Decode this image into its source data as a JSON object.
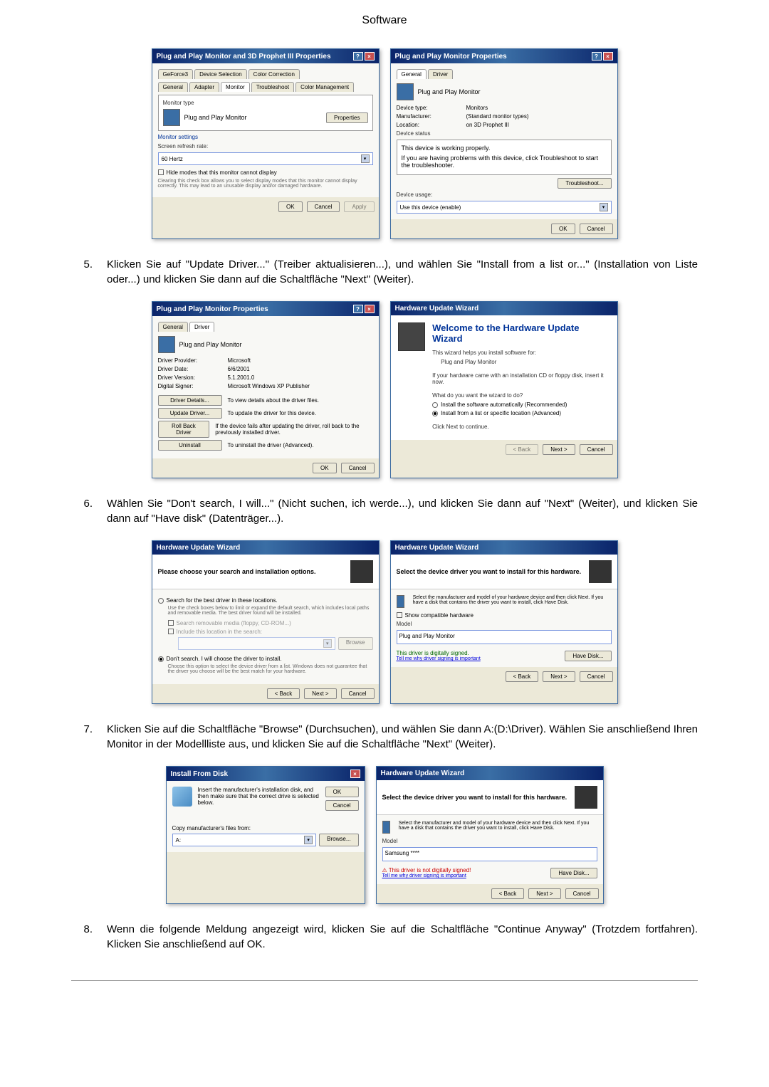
{
  "header": "Software",
  "step5": {
    "num": "5.",
    "text": "Klicken Sie auf \"Update Driver...\" (Treiber aktualisieren...), und wählen Sie \"Install from a list or...\" (Installation von Liste oder...) und klicken Sie dann auf die Schaltfläche \"Next\" (Weiter)."
  },
  "step6": {
    "num": "6.",
    "text": "Wählen Sie \"Don't search, I will...\" (Nicht suchen, ich werde...), und klicken Sie dann auf \"Next\" (Weiter), und klicken Sie dann auf \"Have disk\" (Datenträger...)."
  },
  "step7": {
    "num": "7.",
    "text": "Klicken Sie auf die Schaltfläche \"Browse\" (Durchsuchen), und wählen Sie dann A:(D:\\Driver). Wählen Sie anschließend Ihren Monitor in der Modellliste aus, und klicken Sie auf die Schaltfläche \"Next\" (Weiter)."
  },
  "step8": {
    "num": "8.",
    "text": "Wenn die folgende Meldung angezeigt wird, klicken Sie auf die Schaltfläche \"Continue Anyway\" (Trotzdem fortfahren). Klicken Sie anschließend auf OK."
  },
  "dialog1": {
    "title": "Plug and Play Monitor and 3D Prophet III Properties",
    "tabs": [
      "GeForce3",
      "Device Selection",
      "Color Correction"
    ],
    "tabs2": [
      "General",
      "Adapter",
      "Monitor",
      "Troubleshoot",
      "Color Management"
    ],
    "monitor_type_label": "Monitor type",
    "monitor_type": "Plug and Play Monitor",
    "properties_btn": "Properties",
    "monitor_settings": "Monitor settings",
    "refresh_label": "Screen refresh rate:",
    "refresh_value": "60 Hertz",
    "hide_modes": "Hide modes that this monitor cannot display",
    "hide_desc": "Clearing this check box allows you to select display modes that this monitor cannot display correctly. This may lead to an unusable display and/or damaged hardware.",
    "ok": "OK",
    "cancel": "Cancel",
    "apply": "Apply"
  },
  "dialog2": {
    "title": "Plug and Play Monitor Properties",
    "tabs": [
      "General",
      "Driver"
    ],
    "name": "Plug and Play Monitor",
    "device_type_label": "Device type:",
    "device_type": "Monitors",
    "manufacturer_label": "Manufacturer:",
    "manufacturer": "(Standard monitor types)",
    "location_label": "Location:",
    "location": "on 3D Prophet III",
    "status_label": "Device status",
    "status_text": "This device is working properly.",
    "status_desc": "If you are having problems with this device, click Troubleshoot to start the troubleshooter.",
    "troubleshoot": "Troubleshoot...",
    "usage_label": "Device usage:",
    "usage_value": "Use this device (enable)",
    "ok": "OK",
    "cancel": "Cancel"
  },
  "dialog3": {
    "title": "Plug and Play Monitor Properties",
    "tabs": [
      "General",
      "Driver"
    ],
    "name": "Plug and Play Monitor",
    "provider_label": "Driver Provider:",
    "provider": "Microsoft",
    "date_label": "Driver Date:",
    "date": "6/6/2001",
    "version_label": "Driver Version:",
    "version": "5.1.2001.0",
    "signer_label": "Digital Signer:",
    "signer": "Microsoft Windows XP Publisher",
    "details_btn": "Driver Details...",
    "details_desc": "To view details about the driver files.",
    "update_btn": "Update Driver...",
    "update_desc": "To update the driver for this device.",
    "rollback_btn": "Roll Back Driver",
    "rollback_desc": "If the device fails after updating the driver, roll back to the previously installed driver.",
    "uninstall_btn": "Uninstall",
    "uninstall_desc": "To uninstall the driver (Advanced).",
    "ok": "OK",
    "cancel": "Cancel"
  },
  "dialog4": {
    "title": "Hardware Update Wizard",
    "welcome": "Welcome to the Hardware Update Wizard",
    "desc1": "This wizard helps you install software for:",
    "desc2": "Plug and Play Monitor",
    "desc3": "If your hardware came with an installation CD or floppy disk, insert it now.",
    "question": "What do you want the wizard to do?",
    "opt1": "Install the software automatically (Recommended)",
    "opt2": "Install from a list or specific location (Advanced)",
    "continue": "Click Next to continue.",
    "back": "< Back",
    "next": "Next >",
    "cancel": "Cancel"
  },
  "dialog5": {
    "title": "Hardware Update Wizard",
    "header": "Please choose your search and installation options.",
    "opt1": "Search for the best driver in these locations.",
    "opt1_desc": "Use the check boxes below to limit or expand the default search, which includes local paths and removable media. The best driver found will be installed.",
    "check1": "Search removable media (floppy, CD-ROM...)",
    "check2": "Include this location in the search:",
    "browse": "Browse",
    "opt2": "Don't search. I will choose the driver to install.",
    "opt2_desc": "Choose this option to select the device driver from a list. Windows does not guarantee that the driver you choose will be the best match for your hardware.",
    "back": "< Back",
    "next": "Next >",
    "cancel": "Cancel"
  },
  "dialog6": {
    "title": "Hardware Update Wizard",
    "header": "Select the device driver you want to install for this hardware.",
    "desc": "Select the manufacturer and model of your hardware device and then click Next. If you have a disk that contains the driver you want to install, click Have Disk.",
    "compat_label": "Show compatible hardware",
    "model_label": "Model",
    "model": "Plug and Play Monitor",
    "signed": "This driver is digitally signed.",
    "tell_why": "Tell me why driver signing is important",
    "have_disk": "Have Disk...",
    "back": "< Back",
    "next": "Next >",
    "cancel": "Cancel"
  },
  "dialog7": {
    "title": "Install From Disk",
    "desc": "Insert the manufacturer's installation disk, and then make sure that the correct drive is selected below.",
    "ok": "OK",
    "cancel": "Cancel",
    "copy_label": "Copy manufacturer's files from:",
    "browse": "Browse..."
  },
  "dialog8": {
    "title": "Hardware Update Wizard",
    "header": "Select the device driver you want to install for this hardware.",
    "desc": "Select the manufacturer and model of your hardware device and then click Next. If you have a disk that contains the driver you want to install, click Have Disk.",
    "model_label": "Model",
    "model": "Samsung ****",
    "not_signed": "This driver is not digitally signed!",
    "tell_why": "Tell me why driver signing is important",
    "have_disk": "Have Disk...",
    "back": "< Back",
    "next": "Next >",
    "cancel": "Cancel"
  }
}
